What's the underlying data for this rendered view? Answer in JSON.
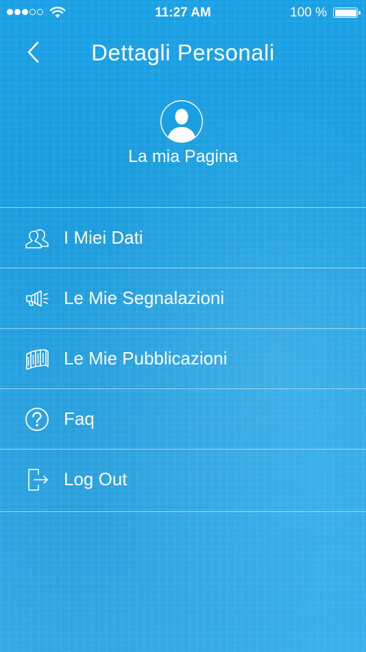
{
  "status_bar": {
    "time": "11:27 AM",
    "battery": "100 %",
    "signal_icon": "signal-dots-icon",
    "wifi_icon": "wifi-icon",
    "battery_icon": "battery-icon"
  },
  "nav": {
    "title": "Dettagli Personali",
    "back_icon": "chevron-left-icon"
  },
  "profile": {
    "avatar_icon": "user-avatar-icon",
    "label": "La mia Pagina"
  },
  "menu": {
    "items": [
      {
        "label": "I Miei Dati",
        "icon": "users-icon"
      },
      {
        "label": "Le Mie Segnalazioni",
        "icon": "megaphone-icon"
      },
      {
        "label": "Le Mie Pubblicazioni",
        "icon": "books-icon"
      },
      {
        "label": "Faq",
        "icon": "question-circle-icon"
      },
      {
        "label": "Log Out",
        "icon": "logout-icon"
      }
    ]
  },
  "colors": {
    "background": "#1aa0e4",
    "foreground": "#ffffff"
  }
}
